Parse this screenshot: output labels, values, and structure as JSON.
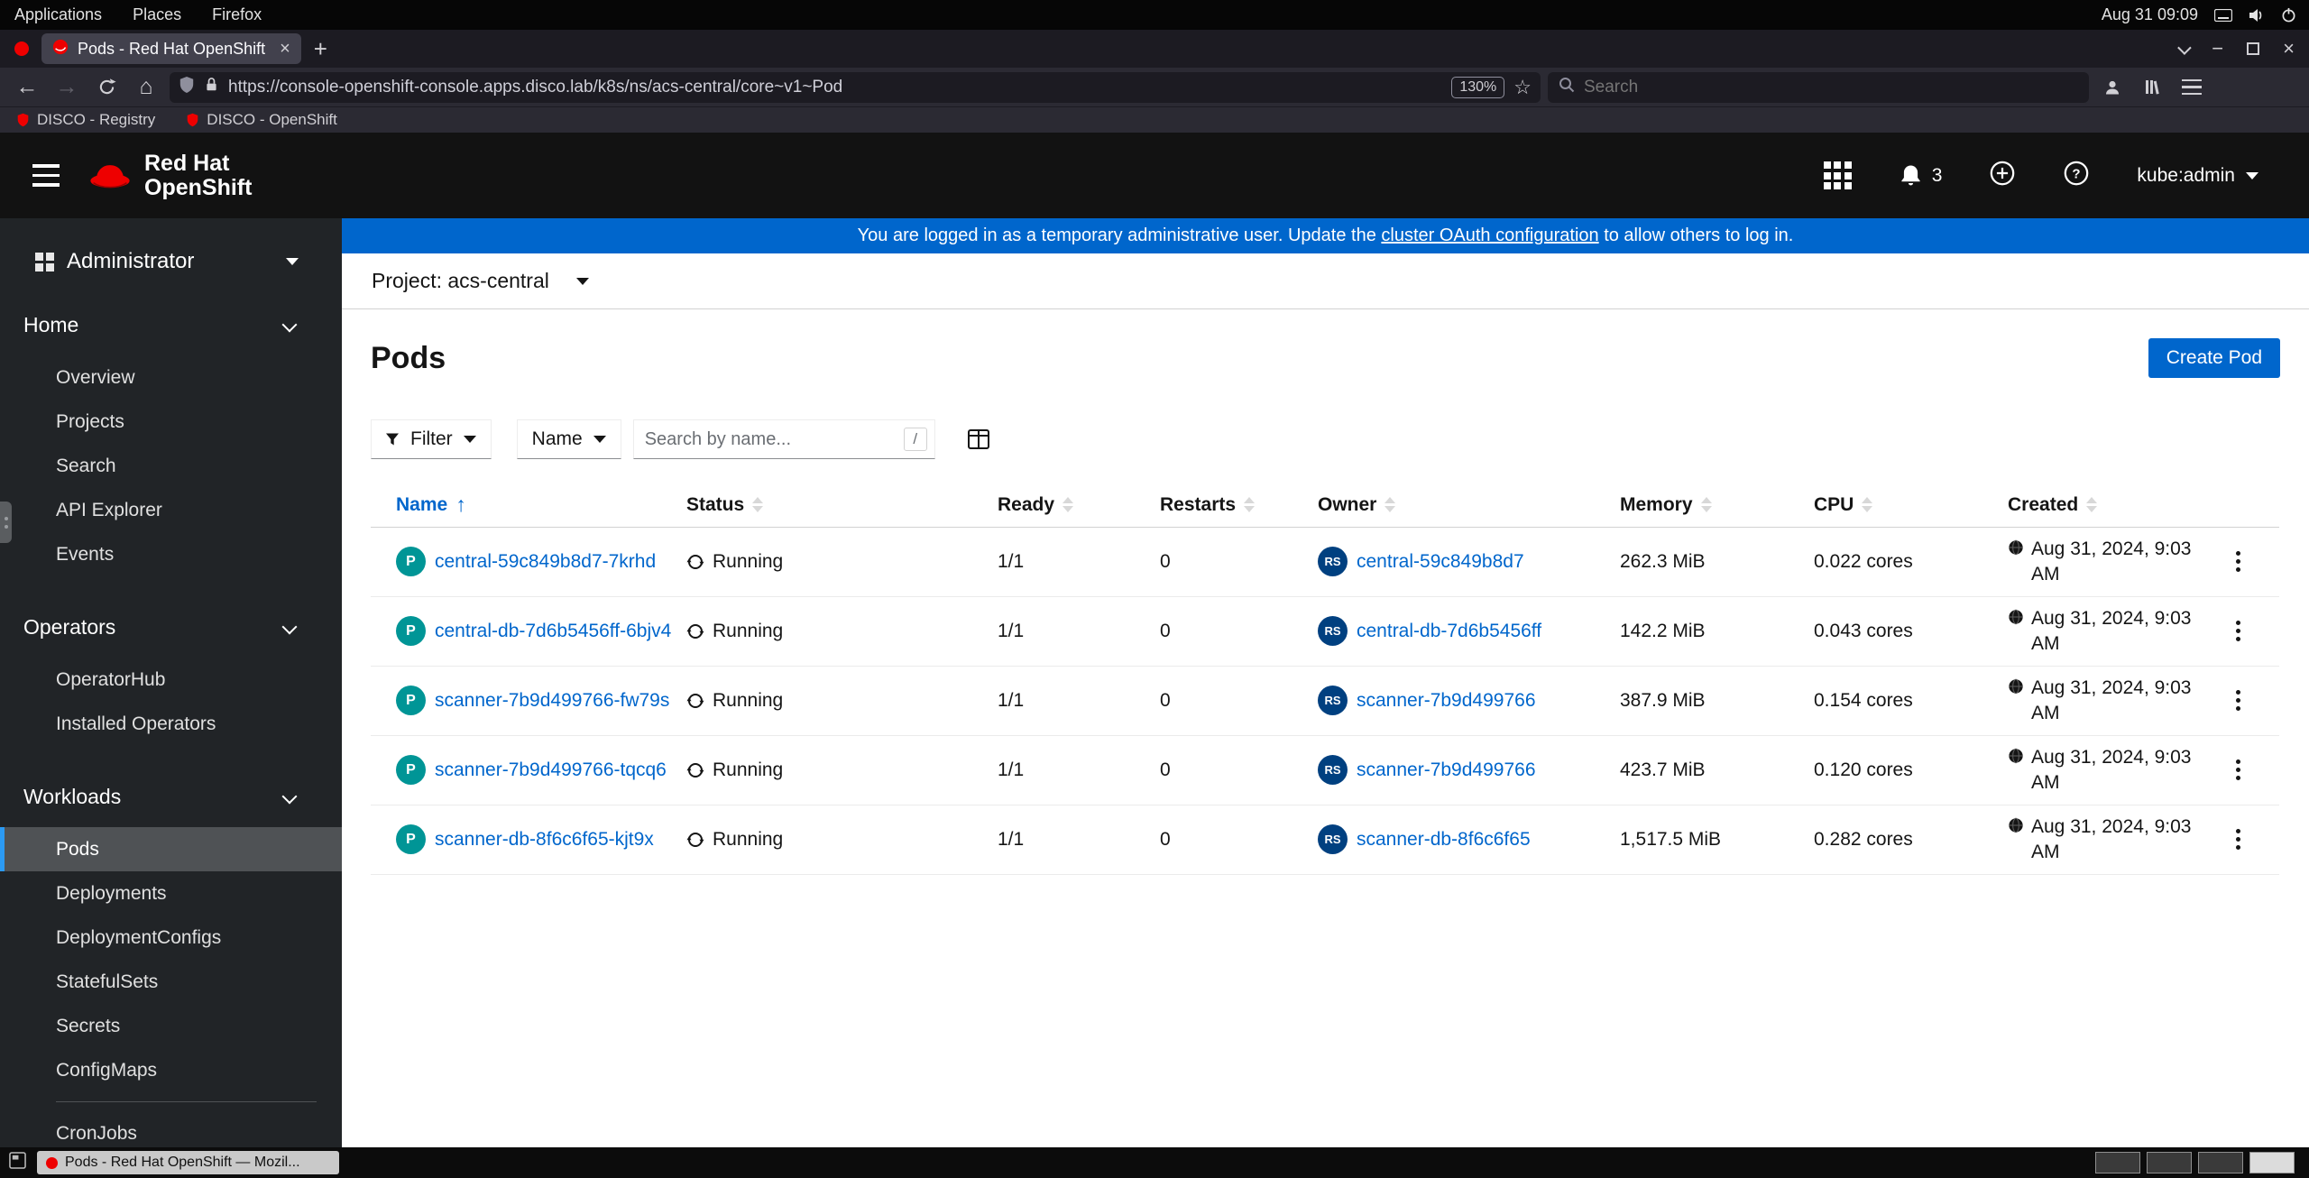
{
  "system_bar": {
    "menus": [
      "Applications",
      "Places",
      "Firefox"
    ],
    "clock": "Aug 31 09:09"
  },
  "browser": {
    "active_tab_title": "Pods - Red Hat OpenShift",
    "url": "https://console-openshift-console.apps.disco.lab/k8s/ns/acs-central/core~v1~Pod",
    "zoom_level": "130%",
    "search_placeholder": "Search",
    "bookmarks": [
      {
        "label": "DISCO - Registry"
      },
      {
        "label": "DISCO - OpenShift"
      }
    ]
  },
  "masthead": {
    "brand_top": "Red Hat",
    "brand_bottom": "OpenShift",
    "notification_count": "3",
    "username": "kube:admin"
  },
  "banner": {
    "prefix": "You are logged in as a temporary administrative user. Update the ",
    "link_text": "cluster OAuth configuration",
    "suffix": " to allow others to log in."
  },
  "sidebar": {
    "perspective": "Administrator",
    "sections": [
      {
        "label": "Home",
        "items": [
          {
            "label": "Overview"
          },
          {
            "label": "Projects"
          },
          {
            "label": "Search"
          },
          {
            "label": "API Explorer"
          },
          {
            "label": "Events"
          }
        ]
      },
      {
        "label": "Operators",
        "items": [
          {
            "label": "OperatorHub"
          },
          {
            "label": "Installed Operators"
          }
        ]
      },
      {
        "label": "Workloads",
        "items": [
          {
            "label": "Pods"
          },
          {
            "label": "Deployments"
          },
          {
            "label": "DeploymentConfigs"
          },
          {
            "label": "StatefulSets"
          },
          {
            "label": "Secrets"
          },
          {
            "label": "ConfigMaps"
          },
          {
            "label": "CronJobs"
          }
        ]
      }
    ]
  },
  "project_bar": {
    "label": "Project: acs-central"
  },
  "page": {
    "title": "Pods",
    "create_button": "Create Pod"
  },
  "toolbar": {
    "filter_label": "Filter",
    "attribute_label": "Name",
    "search_placeholder": "Search by name...",
    "shortcut_hint": "/"
  },
  "table": {
    "columns": [
      "Name",
      "Status",
      "Ready",
      "Restarts",
      "Owner",
      "Memory",
      "CPU",
      "Created"
    ],
    "pod_badge": "P",
    "owner_badge": "RS",
    "rows": [
      {
        "name": "central-59c849b8d7-7krhd",
        "status": "Running",
        "ready": "1/1",
        "restarts": "0",
        "owner": "central-59c849b8d7",
        "memory": "262.3 MiB",
        "cpu": "0.022 cores",
        "created": "Aug 31, 2024, 9:03 AM"
      },
      {
        "name": "central-db-7d6b5456ff-6bjv4",
        "status": "Running",
        "ready": "1/1",
        "restarts": "0",
        "owner": "central-db-7d6b5456ff",
        "memory": "142.2 MiB",
        "cpu": "0.043 cores",
        "created": "Aug 31, 2024, 9:03 AM"
      },
      {
        "name": "scanner-7b9d499766-fw79s",
        "status": "Running",
        "ready": "1/1",
        "restarts": "0",
        "owner": "scanner-7b9d499766",
        "memory": "387.9 MiB",
        "cpu": "0.154 cores",
        "created": "Aug 31, 2024, 9:03 AM"
      },
      {
        "name": "scanner-7b9d499766-tqcq6",
        "status": "Running",
        "ready": "1/1",
        "restarts": "0",
        "owner": "scanner-7b9d499766",
        "memory": "423.7 MiB",
        "cpu": "0.120 cores",
        "created": "Aug 31, 2024, 9:03 AM"
      },
      {
        "name": "scanner-db-8f6c6f65-kjt9x",
        "status": "Running",
        "ready": "1/1",
        "restarts": "0",
        "owner": "scanner-db-8f6c6f65",
        "memory": "1,517.5 MiB",
        "cpu": "0.282 cores",
        "created": "Aug 31, 2024, 9:03 AM"
      }
    ]
  },
  "taskbar": {
    "window_title": "Pods - Red Hat OpenShift — Mozil..."
  }
}
